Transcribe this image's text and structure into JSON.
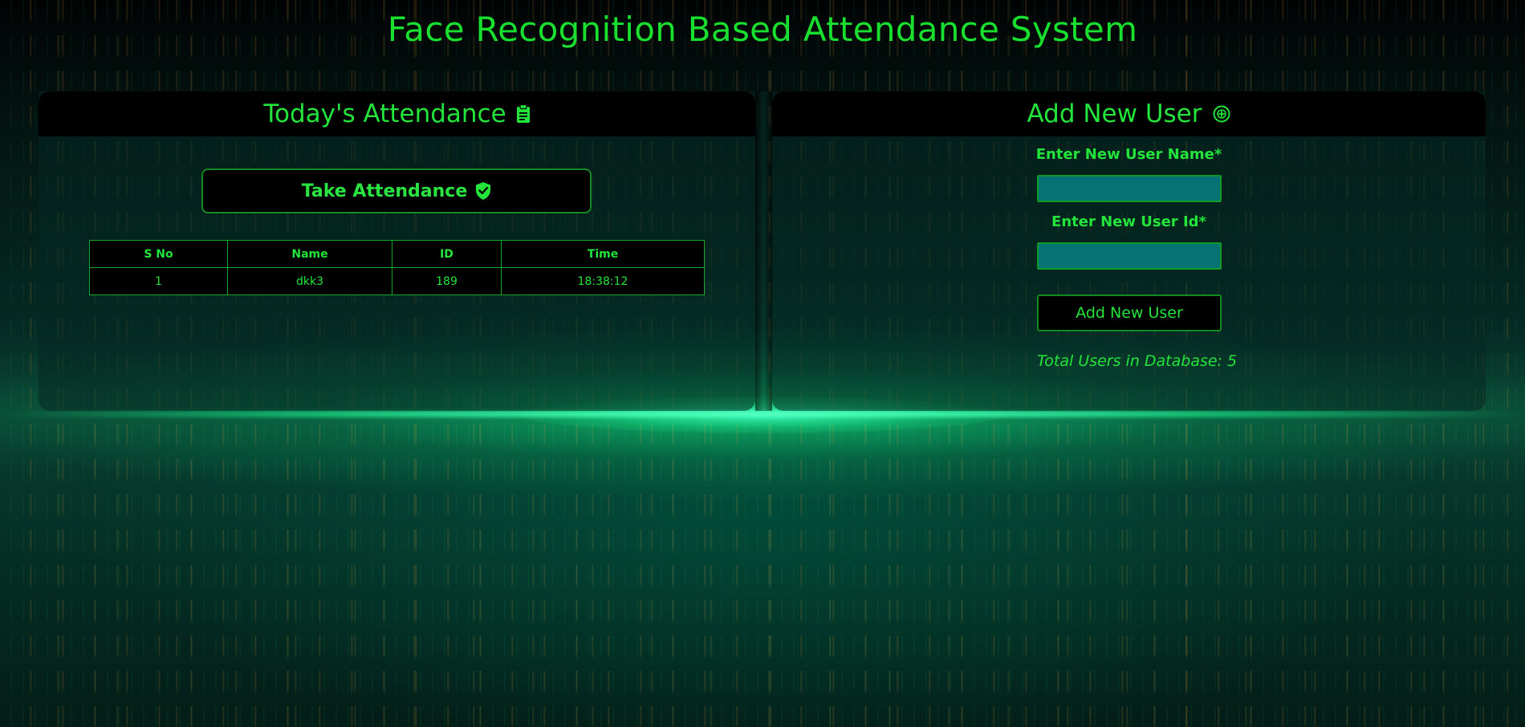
{
  "page": {
    "title": "Face Recognition Based Attendance System"
  },
  "attendance": {
    "title": "Today's Attendance",
    "icon": "clipboard-icon",
    "take_button": {
      "label": "Take Attendance",
      "icon": "shield-check-icon"
    },
    "table": {
      "columns": [
        "S No",
        "Name",
        "ID",
        "Time"
      ],
      "rows": [
        {
          "sno": "1",
          "name": "dkk3",
          "id": "189",
          "time": "18:38:12"
        }
      ]
    }
  },
  "add_user": {
    "title": "Add New User",
    "icon": "plus-circle-icon",
    "name_label": "Enter New User Name*",
    "name_value": "",
    "id_label": "Enter New User Id*",
    "id_value": "",
    "submit_label": "Add New User",
    "total_users_text": "Total Users in Database: 5"
  },
  "colors": {
    "accent_green": "#22e43b",
    "input_bg": "#067273",
    "panel_header_bg": "#000000"
  }
}
